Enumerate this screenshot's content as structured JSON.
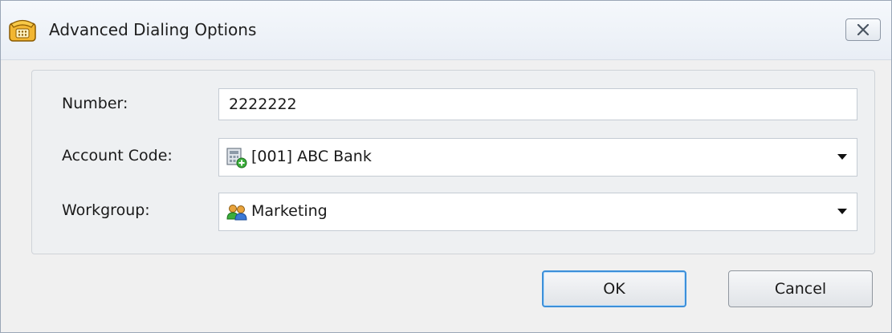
{
  "window": {
    "title": "Advanced Dialing Options",
    "title_icon": "telephone-icon",
    "close_icon": "close-icon"
  },
  "form": {
    "number": {
      "label": "Number:",
      "value": "2222222"
    },
    "account_code": {
      "label": "Account Code:",
      "value": "[001]  ABC Bank",
      "icon": "account-code-icon"
    },
    "workgroup": {
      "label": "Workgroup:",
      "value": "Marketing",
      "icon": "workgroup-icon"
    }
  },
  "buttons": {
    "ok": "OK",
    "cancel": "Cancel"
  },
  "colors": {
    "default_button_border": "#3c8fd9",
    "phone_icon": "#f2b632"
  }
}
